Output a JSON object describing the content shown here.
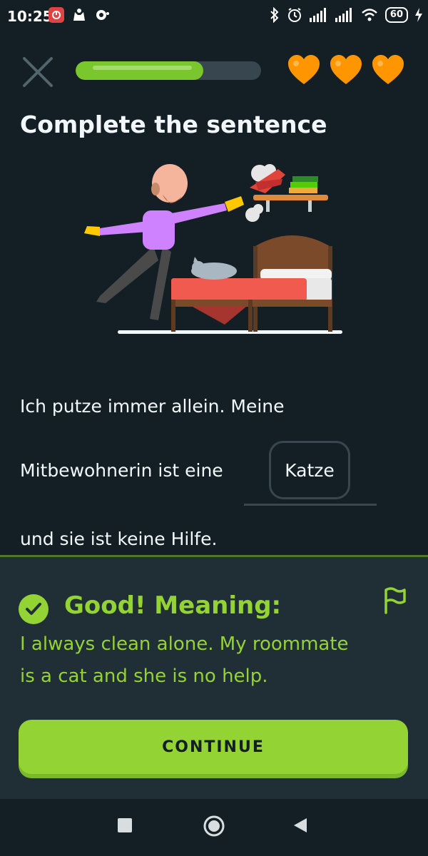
{
  "status_bar": {
    "time": "10:25",
    "battery": "60",
    "icons": [
      "app-badge-icon",
      "cat-icon",
      "settings-icon",
      "bluetooth-icon",
      "alarm-icon",
      "signal-icon",
      "signal-icon",
      "wifi-icon",
      "charging-icon"
    ]
  },
  "lesson": {
    "progress": 0.69,
    "hearts": 3,
    "title": "Complete the sentence"
  },
  "exercise": {
    "line1": "Ich putze immer allein. Meine",
    "line2": "Mitbewohnerin ist eine",
    "selected_word": "Katze",
    "line3": "und sie ist keine Hilfe."
  },
  "feedback": {
    "heading": "Good! Meaning:",
    "translation_line1": "I always clean alone. My roommate",
    "translation_line2": "is a cat and she is no help.",
    "continue_label": "CONTINUE"
  },
  "colors": {
    "background": "#131f24",
    "accent_green": "#93d333",
    "progress_fill": "#79c62d",
    "heart_orange": "#ff9600",
    "sheet": "#202f36"
  },
  "nav_icons": [
    "recents-square-icon",
    "home-circle-icon",
    "back-triangle-icon"
  ]
}
